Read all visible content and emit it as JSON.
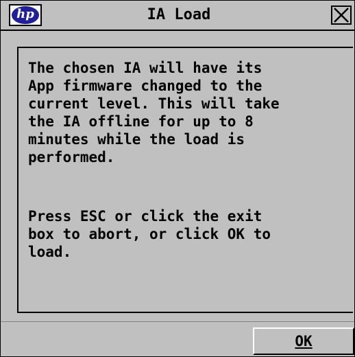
{
  "window": {
    "title": "IA Load",
    "logo_text": "hp",
    "close_icon": "close-x-icon"
  },
  "message": {
    "paragraph1": "The chosen IA will have its\nApp firmware changed to the\ncurrent level. This will take\nthe IA offline for up to 8\nminutes while the load is\nperformed.",
    "paragraph2": "Press ESC or click the exit\nbox to abort, or click OK to\nload."
  },
  "buttons": {
    "ok_label": "OK"
  },
  "colors": {
    "background": "#c0c0c0",
    "logo_blue": "#1f1f9c",
    "text": "#000000"
  }
}
